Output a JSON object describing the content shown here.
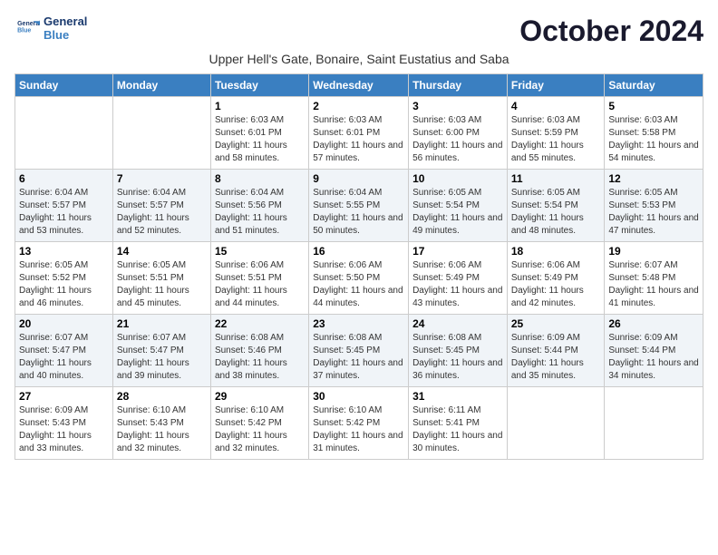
{
  "header": {
    "logo_line1": "General",
    "logo_line2": "Blue",
    "month_title": "October 2024",
    "location": "Upper Hell's Gate, Bonaire, Saint Eustatius and Saba"
  },
  "weekdays": [
    "Sunday",
    "Monday",
    "Tuesday",
    "Wednesday",
    "Thursday",
    "Friday",
    "Saturday"
  ],
  "weeks": [
    [
      {
        "day": "",
        "info": ""
      },
      {
        "day": "",
        "info": ""
      },
      {
        "day": "1",
        "info": "Sunrise: 6:03 AM\nSunset: 6:01 PM\nDaylight: 11 hours and 58 minutes."
      },
      {
        "day": "2",
        "info": "Sunrise: 6:03 AM\nSunset: 6:01 PM\nDaylight: 11 hours and 57 minutes."
      },
      {
        "day": "3",
        "info": "Sunrise: 6:03 AM\nSunset: 6:00 PM\nDaylight: 11 hours and 56 minutes."
      },
      {
        "day": "4",
        "info": "Sunrise: 6:03 AM\nSunset: 5:59 PM\nDaylight: 11 hours and 55 minutes."
      },
      {
        "day": "5",
        "info": "Sunrise: 6:03 AM\nSunset: 5:58 PM\nDaylight: 11 hours and 54 minutes."
      }
    ],
    [
      {
        "day": "6",
        "info": "Sunrise: 6:04 AM\nSunset: 5:57 PM\nDaylight: 11 hours and 53 minutes."
      },
      {
        "day": "7",
        "info": "Sunrise: 6:04 AM\nSunset: 5:57 PM\nDaylight: 11 hours and 52 minutes."
      },
      {
        "day": "8",
        "info": "Sunrise: 6:04 AM\nSunset: 5:56 PM\nDaylight: 11 hours and 51 minutes."
      },
      {
        "day": "9",
        "info": "Sunrise: 6:04 AM\nSunset: 5:55 PM\nDaylight: 11 hours and 50 minutes."
      },
      {
        "day": "10",
        "info": "Sunrise: 6:05 AM\nSunset: 5:54 PM\nDaylight: 11 hours and 49 minutes."
      },
      {
        "day": "11",
        "info": "Sunrise: 6:05 AM\nSunset: 5:54 PM\nDaylight: 11 hours and 48 minutes."
      },
      {
        "day": "12",
        "info": "Sunrise: 6:05 AM\nSunset: 5:53 PM\nDaylight: 11 hours and 47 minutes."
      }
    ],
    [
      {
        "day": "13",
        "info": "Sunrise: 6:05 AM\nSunset: 5:52 PM\nDaylight: 11 hours and 46 minutes."
      },
      {
        "day": "14",
        "info": "Sunrise: 6:05 AM\nSunset: 5:51 PM\nDaylight: 11 hours and 45 minutes."
      },
      {
        "day": "15",
        "info": "Sunrise: 6:06 AM\nSunset: 5:51 PM\nDaylight: 11 hours and 44 minutes."
      },
      {
        "day": "16",
        "info": "Sunrise: 6:06 AM\nSunset: 5:50 PM\nDaylight: 11 hours and 44 minutes."
      },
      {
        "day": "17",
        "info": "Sunrise: 6:06 AM\nSunset: 5:49 PM\nDaylight: 11 hours and 43 minutes."
      },
      {
        "day": "18",
        "info": "Sunrise: 6:06 AM\nSunset: 5:49 PM\nDaylight: 11 hours and 42 minutes."
      },
      {
        "day": "19",
        "info": "Sunrise: 6:07 AM\nSunset: 5:48 PM\nDaylight: 11 hours and 41 minutes."
      }
    ],
    [
      {
        "day": "20",
        "info": "Sunrise: 6:07 AM\nSunset: 5:47 PM\nDaylight: 11 hours and 40 minutes."
      },
      {
        "day": "21",
        "info": "Sunrise: 6:07 AM\nSunset: 5:47 PM\nDaylight: 11 hours and 39 minutes."
      },
      {
        "day": "22",
        "info": "Sunrise: 6:08 AM\nSunset: 5:46 PM\nDaylight: 11 hours and 38 minutes."
      },
      {
        "day": "23",
        "info": "Sunrise: 6:08 AM\nSunset: 5:45 PM\nDaylight: 11 hours and 37 minutes."
      },
      {
        "day": "24",
        "info": "Sunrise: 6:08 AM\nSunset: 5:45 PM\nDaylight: 11 hours and 36 minutes."
      },
      {
        "day": "25",
        "info": "Sunrise: 6:09 AM\nSunset: 5:44 PM\nDaylight: 11 hours and 35 minutes."
      },
      {
        "day": "26",
        "info": "Sunrise: 6:09 AM\nSunset: 5:44 PM\nDaylight: 11 hours and 34 minutes."
      }
    ],
    [
      {
        "day": "27",
        "info": "Sunrise: 6:09 AM\nSunset: 5:43 PM\nDaylight: 11 hours and 33 minutes."
      },
      {
        "day": "28",
        "info": "Sunrise: 6:10 AM\nSunset: 5:43 PM\nDaylight: 11 hours and 32 minutes."
      },
      {
        "day": "29",
        "info": "Sunrise: 6:10 AM\nSunset: 5:42 PM\nDaylight: 11 hours and 32 minutes."
      },
      {
        "day": "30",
        "info": "Sunrise: 6:10 AM\nSunset: 5:42 PM\nDaylight: 11 hours and 31 minutes."
      },
      {
        "day": "31",
        "info": "Sunrise: 6:11 AM\nSunset: 5:41 PM\nDaylight: 11 hours and 30 minutes."
      },
      {
        "day": "",
        "info": ""
      },
      {
        "day": "",
        "info": ""
      }
    ]
  ]
}
